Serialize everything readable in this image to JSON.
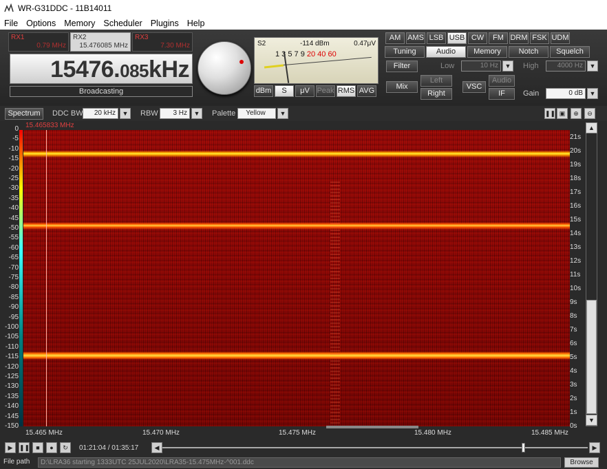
{
  "window": {
    "title": "WR-G31DDC - 11B14011"
  },
  "menu": [
    "File",
    "Options",
    "Memory",
    "Scheduler",
    "Plugins",
    "Help"
  ],
  "receivers": [
    {
      "name": "RX1",
      "freq": "0.79 MHz"
    },
    {
      "name": "RX2",
      "freq": "15.476085 MHz"
    },
    {
      "name": "RX3",
      "freq": "7.30 MHz"
    }
  ],
  "frequency": {
    "main": "15476.",
    "small": "085",
    "unit": "kHz"
  },
  "mode_label": "Broadcasting",
  "smeter": {
    "s": "S2",
    "dbm": "-114 dBm",
    "uv": "0.47μV",
    "scale_black": "1 3 5 7 9",
    "scale_red": "20 40 60",
    "buttons": [
      "dBm",
      "S",
      "μV",
      "Peak",
      "RMS",
      "AVG"
    ]
  },
  "modes": [
    "AM",
    "AMS",
    "LSB",
    "USB",
    "CW",
    "FM",
    "DRM",
    "FSK",
    "UDM"
  ],
  "panel_tabs": [
    "Tuning",
    "Audio",
    "Memory",
    "Notch",
    "Squelch"
  ],
  "audio": {
    "filter": "Filter",
    "low_label": "Low",
    "low_value": "10 Hz",
    "high_label": "High",
    "high_value": "4000 Hz",
    "mix": "Mix",
    "left": "Left",
    "right": "Right",
    "vsc": "VSC",
    "audio": "Audio",
    "if": "IF",
    "gain_label": "Gain",
    "gain_value": "0 dB"
  },
  "spectrum_toolbar": {
    "spectrum": "Spectrum",
    "ddc_bw_label": "DDC BW",
    "ddc_bw_value": "20 kHz",
    "rbw_label": "RBW",
    "rbw_value": "3 Hz",
    "palette_label": "Palette",
    "palette_value": "Yellow"
  },
  "waterfall": {
    "cursor_freq": "15.465833 MHz",
    "y_ticks": [
      "0",
      "-5",
      "-10",
      "-15",
      "-20",
      "-25",
      "-30",
      "-35",
      "-40",
      "-45",
      "-50",
      "-55",
      "-60",
      "-65",
      "-70",
      "-75",
      "-80",
      "-85",
      "-90",
      "-95",
      "-100",
      "-105",
      "-110",
      "-115",
      "-120",
      "-125",
      "-130",
      "-135",
      "-140",
      "-145",
      "-150"
    ],
    "time_ticks": [
      "21s",
      "20s",
      "19s",
      "18s",
      "17s",
      "16s",
      "15s",
      "14s",
      "13s",
      "12s",
      "11s",
      "10s",
      "9s",
      "8s",
      "7s",
      "6s",
      "5s",
      "4s",
      "3s",
      "2s",
      "1s",
      "0s"
    ],
    "x_ticks": [
      "15.465 MHz",
      "15.470 MHz",
      "15.475 MHz",
      "15.480 MHz",
      "15.485 MHz"
    ]
  },
  "playback": {
    "time": "01:21:04 / 01:35:17"
  },
  "file": {
    "label": "File path",
    "path": "D:\\LRA36 starting 1333UTC 25JUL2020\\LRA35-15.475MHz-^001.ddc",
    "browse": "Browse"
  },
  "colors": {
    "waterfall_bg": "#8c0806",
    "signal": "#fff23a",
    "accent_red": "#e04040"
  }
}
